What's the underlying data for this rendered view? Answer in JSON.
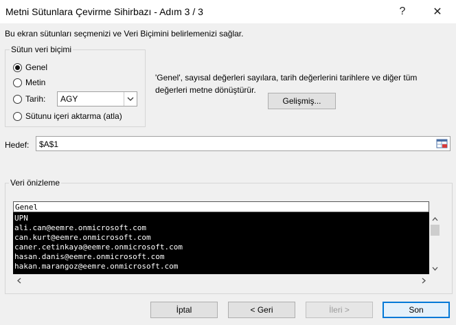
{
  "window": {
    "title": "Metni Sütunlara Çevirme Sihirbazı - Adım 3 / 3",
    "help_label": "?",
    "close_label": "✕"
  },
  "description": "Bu ekran sütunları seçmenizi ve Veri Biçimini belirlemenizi  sağlar.",
  "column_format": {
    "group_label": "Sütun veri biçimi",
    "options": [
      {
        "label": "Genel",
        "selected": true
      },
      {
        "label": "Metin",
        "selected": false
      },
      {
        "label": "Tarih:",
        "selected": false
      },
      {
        "label": "Sütunu içeri aktarma (atla)",
        "selected": false
      }
    ],
    "date_format": "AGY"
  },
  "info_text": "'Genel', sayısal değerleri sayılara, tarih değerlerini tarihlere ve diğer tüm değerleri metne dönüştürür.",
  "advanced_button": "Gelişmiş...",
  "destination": {
    "label": "Hedef:",
    "value": "$A$1"
  },
  "preview": {
    "group_label": "Veri önizleme",
    "column_header": "Genel",
    "rows": [
      "UPN",
      "ali.can@eemre.onmicrosoft.com",
      "can.kurt@eemre.onmicrosoft.com",
      "caner.cetinkaya@eemre.onmicrosoft.com",
      "hasan.danis@eemre.onmicrosoft.com",
      "hakan.marangoz@eemre.onmicrosoft.com"
    ]
  },
  "footer": {
    "cancel": "İptal",
    "back": "< Geri",
    "next": "İleri >",
    "finish": "Son"
  }
}
